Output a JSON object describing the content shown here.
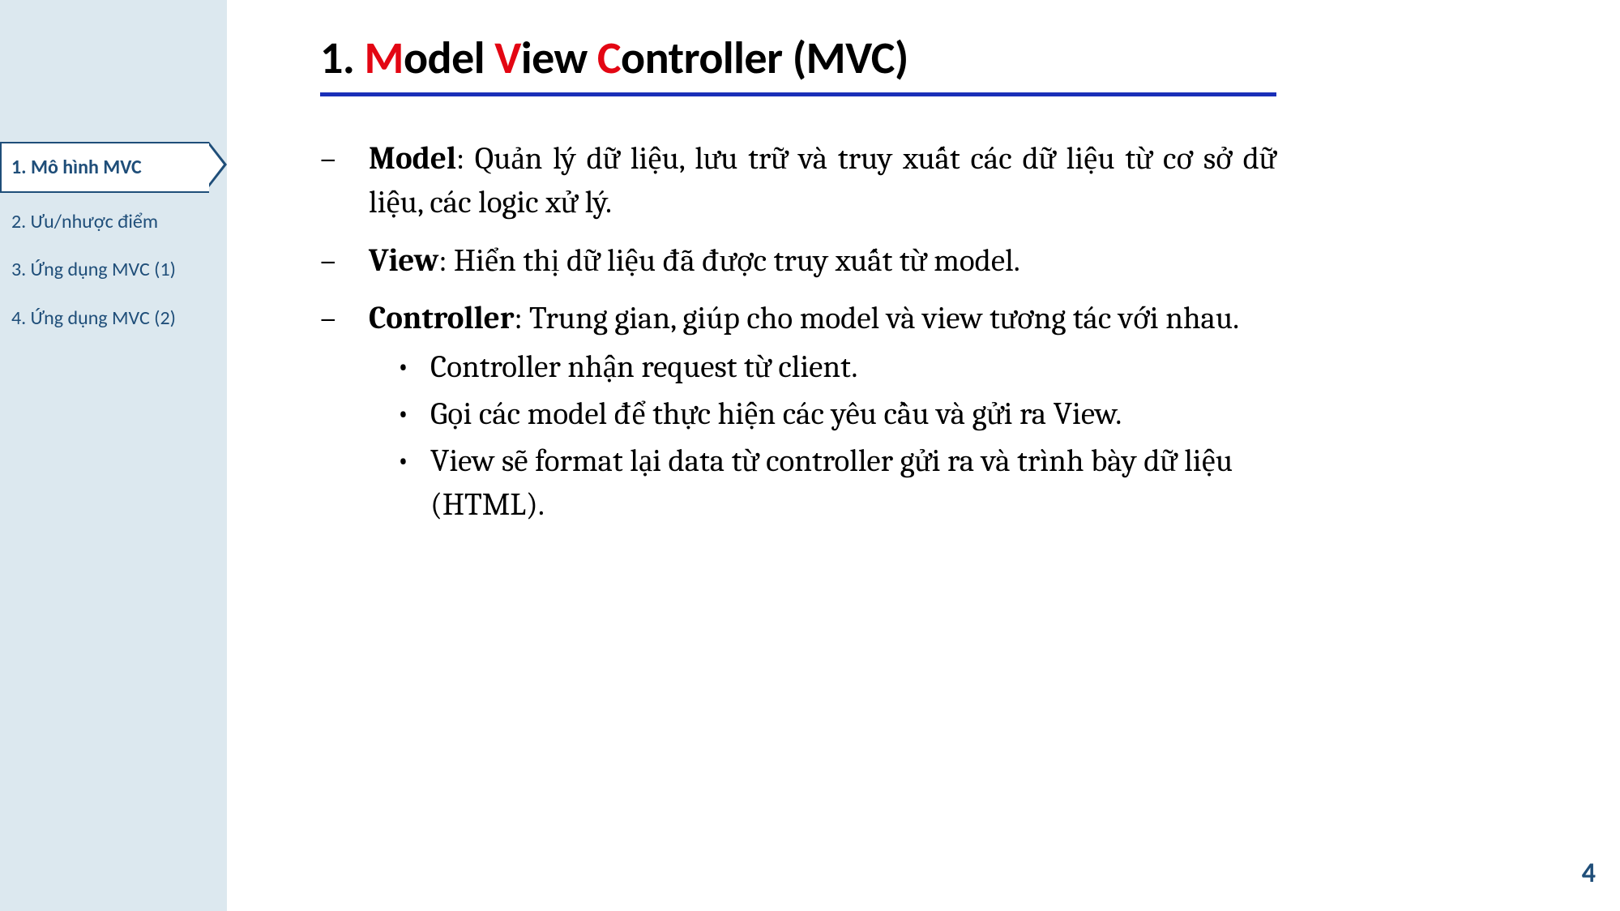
{
  "sidebar": {
    "items": [
      {
        "label": "1. Mô hình MVC",
        "active": true
      },
      {
        "label": "2. Ưu/nhược điểm",
        "active": false
      },
      {
        "label": "3. Ứng dụng MVC (1)",
        "active": false
      },
      {
        "label": "4. Ứng dụng MVC (2)",
        "active": false
      }
    ]
  },
  "title": {
    "prefix": "1. ",
    "m": "M",
    "model_rest": "odel ",
    "v": "V",
    "view_rest": "iew ",
    "c": "C",
    "controller_rest": "ontroller (MVC)"
  },
  "bullets": {
    "model": {
      "term": "Model",
      "text": ": Quản lý dữ liệu, lưu trữ và truy xuất các dữ liệu từ cơ sở dữ liệu, các logic xử lý."
    },
    "view": {
      "term": "View",
      "text": ": Hiển thị dữ liệu đã được truy xuất từ model."
    },
    "controller": {
      "term": "Controller",
      "text": ": Trung gian, giúp cho model và view tương tác với nhau."
    },
    "sub": [
      "Controller nhận request từ client.",
      "Gọi các model để thực hiện các yêu cầu và gửi ra View.",
      "View sẽ format lại data từ controller gửi ra và trình bày dữ liệu (HTML)."
    ]
  },
  "page_number": "4"
}
